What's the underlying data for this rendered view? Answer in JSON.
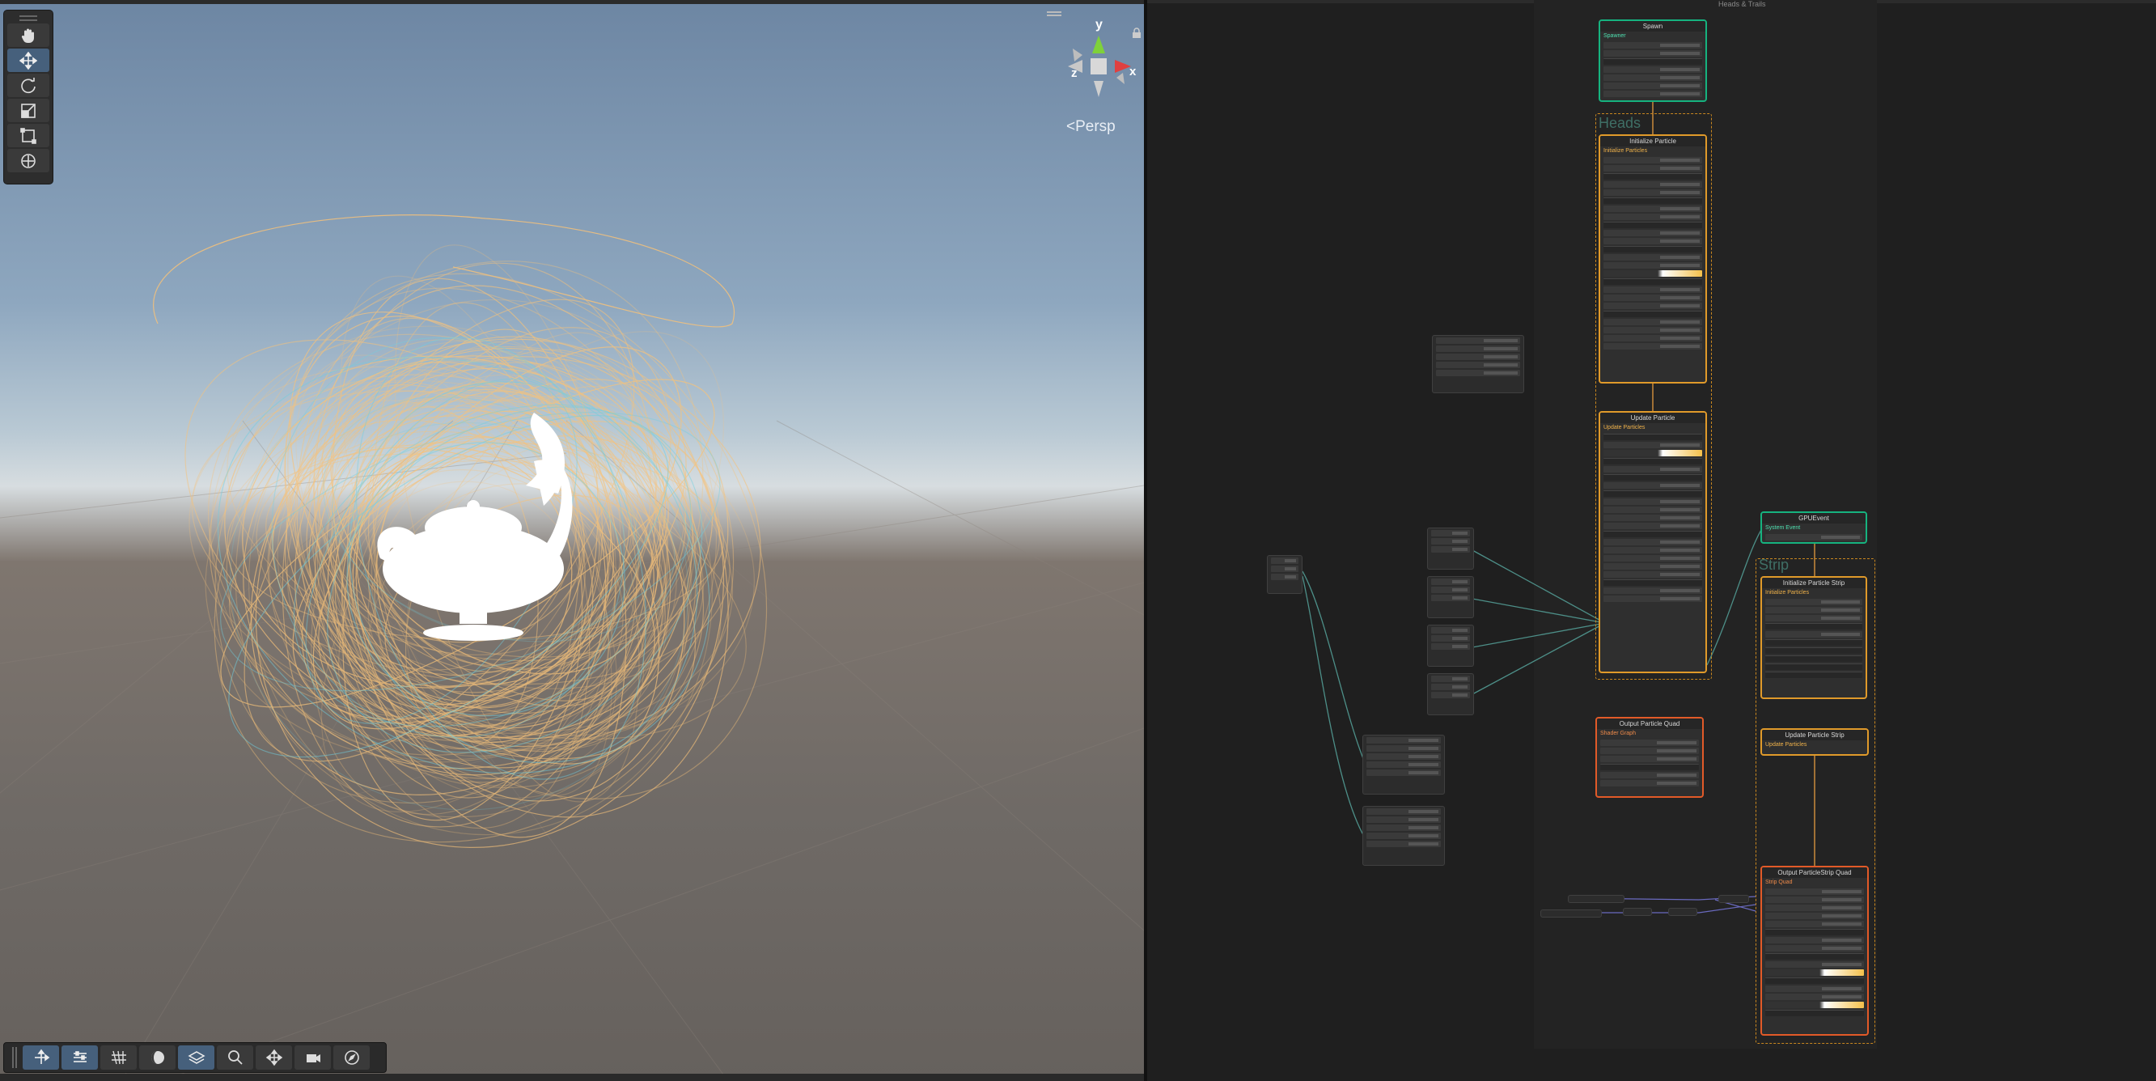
{
  "scene": {
    "view_mode": "Persp",
    "gizmo_axes": {
      "x": "x",
      "y": "y",
      "z": "z"
    },
    "tools": [
      {
        "name": "hand-tool",
        "icon": "hand-icon",
        "active": false
      },
      {
        "name": "move-tool",
        "icon": "move-icon",
        "active": true
      },
      {
        "name": "rotate-tool",
        "icon": "rotate-icon",
        "active": false
      },
      {
        "name": "scale-tool",
        "icon": "scale-icon",
        "active": false
      },
      {
        "name": "rect-tool",
        "icon": "rect-icon",
        "active": false
      },
      {
        "name": "transform-tool",
        "icon": "transform-icon",
        "active": false
      }
    ],
    "bottom_tools": [
      {
        "name": "move-overlay",
        "icon": "move-icon",
        "active": true
      },
      {
        "name": "settings-overlay",
        "icon": "sliders-icon",
        "active": true
      },
      {
        "name": "grid-overlay",
        "icon": "grid-icon",
        "active": false
      },
      {
        "name": "shading-overlay",
        "icon": "shading-icon",
        "active": false
      },
      {
        "name": "layers-overlay",
        "icon": "layers-icon",
        "active": true
      },
      {
        "name": "search-overlay",
        "icon": "search-icon",
        "active": false
      },
      {
        "name": "snap-overlay",
        "icon": "snap-icon",
        "active": false
      },
      {
        "name": "camera-overlay",
        "icon": "camera-icon",
        "active": false
      },
      {
        "name": "gizmo-overlay",
        "icon": "compass-icon",
        "active": false
      }
    ]
  },
  "graph": {
    "title": "Heads & Trails",
    "groups": {
      "heads": "Heads",
      "strip": "Strip"
    },
    "nodes": {
      "spawn_heads": {
        "title": "Spawn",
        "sub": "Spawner"
      },
      "init_heads": {
        "title": "Initialize Particle",
        "sub": "Initialize Particles"
      },
      "update_heads": {
        "title": "Update Particle",
        "sub": "Update Particles"
      },
      "output_heads": {
        "title": "Output Particle Quad",
        "sub": "Shader Graph"
      },
      "gpu_event": {
        "title": "GPUEvent",
        "sub": "System Event"
      },
      "init_strip": {
        "title": "Initialize Particle Strip",
        "sub": "Initialize Particles"
      },
      "update_strip": {
        "title": "Update Particle Strip",
        "sub": "Update Particles"
      },
      "output_strip": {
        "title": "Output ParticleStrip Quad",
        "sub": "Strip Quad"
      }
    }
  },
  "colors": {
    "context_spawn": "#16b37f",
    "context_update": "#e09a2a",
    "context_output": "#e25a28",
    "active_tool": "#46607c"
  }
}
